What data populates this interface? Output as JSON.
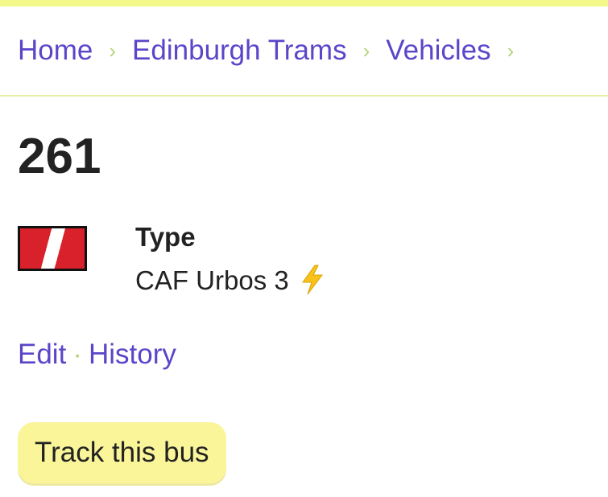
{
  "breadcrumb": {
    "items": [
      {
        "label": "Home"
      },
      {
        "label": "Edinburgh Trams"
      },
      {
        "label": "Vehicles"
      }
    ],
    "separator": "›"
  },
  "vehicle": {
    "fleet_number": "261",
    "type_label": "Type",
    "type_value": "CAF Urbos 3",
    "type_icon": "lightning-bolt-icon",
    "livery_colors": [
      "#d8212a",
      "#ffffff"
    ]
  },
  "actions": {
    "edit_label": "Edit",
    "separator": "·",
    "history_label": "History"
  },
  "track_button": {
    "label": "Track this bus"
  },
  "colors": {
    "accent_link": "#5a46c9",
    "top_bar": "#f4f78a",
    "button_bg": "#fbf59a",
    "separator": "#b7d37b"
  }
}
